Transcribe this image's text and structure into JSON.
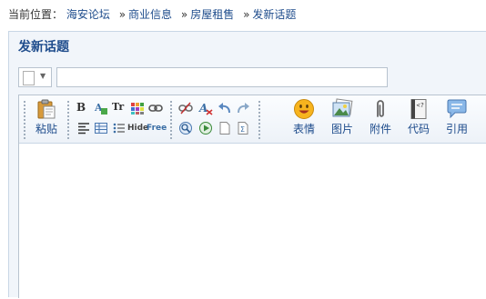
{
  "breadcrumb": {
    "lead": "当前位置：",
    "items": [
      "海安论坛",
      "商业信息",
      "房屋租售",
      "发新话题"
    ],
    "separator": "»"
  },
  "panel": {
    "title": "发新话题"
  },
  "subject": {
    "value": "",
    "placeholder": ""
  },
  "toolbar": {
    "paste_label": "粘贴",
    "bold_glyph": "B",
    "font_size_glyph": "Tr",
    "hide_label": "Hide",
    "free_label": "Free",
    "big_buttons": {
      "emoticon": "表情",
      "image": "图片",
      "attachment": "附件",
      "code": "代码",
      "quote": "引用"
    },
    "code_icon_glyph": "<?"
  },
  "colors": {
    "link": "#1e4c8c",
    "panel_bg": "#f1f5fa",
    "border": "#b8c3cf"
  }
}
